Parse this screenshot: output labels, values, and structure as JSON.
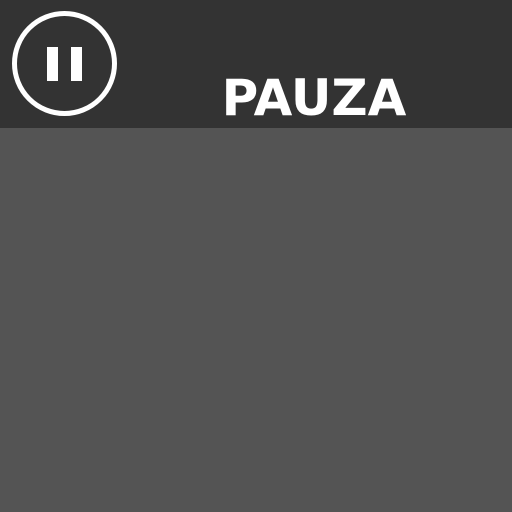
{
  "header": {
    "title": "PAUZA",
    "pause_icon": "pause-icon"
  },
  "colors": {
    "header_background": "#333333",
    "main_background": "#545454",
    "foreground": "#ffffff"
  }
}
